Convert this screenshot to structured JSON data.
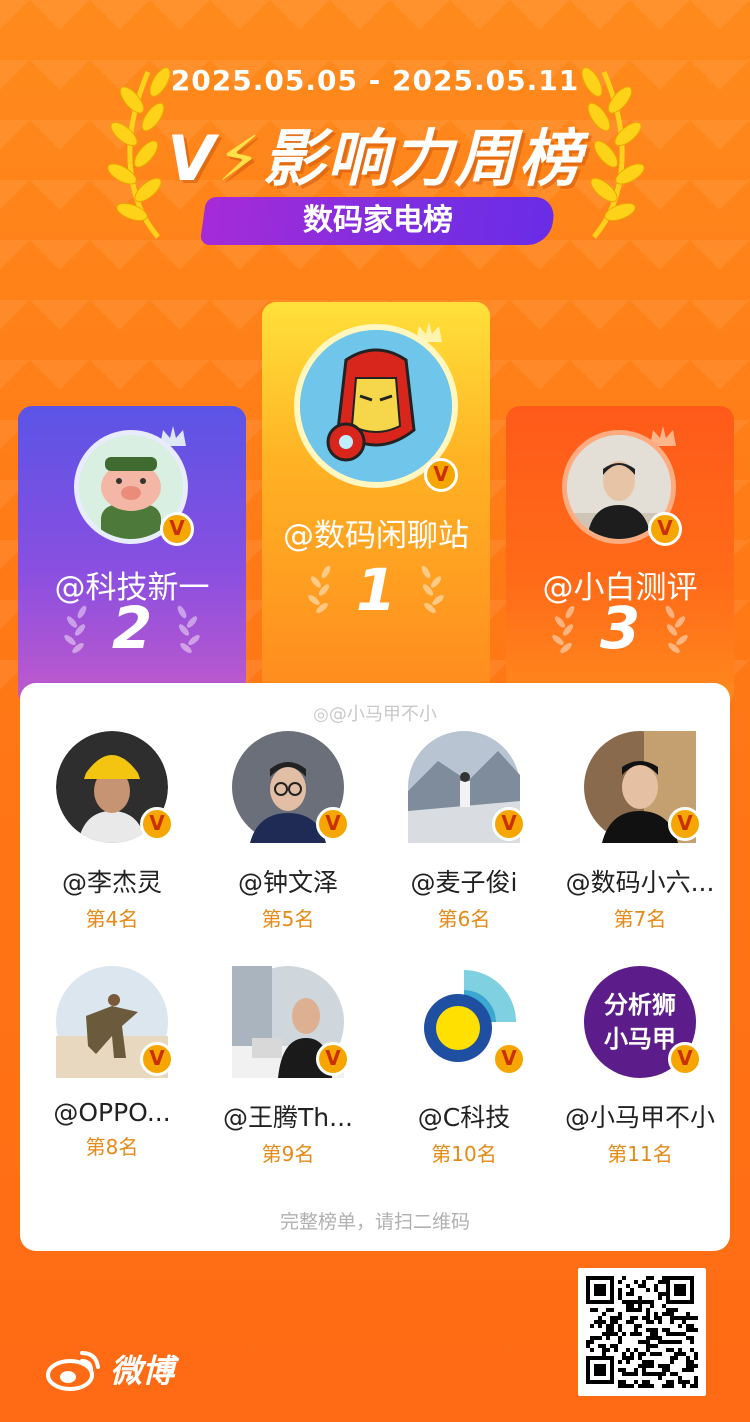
{
  "header": {
    "date_range": "2025.05.05 - 2025.05.11",
    "title_prefix": "V",
    "title_bolt": "影",
    "title_rest": "响力周榜",
    "category": "数码家电榜"
  },
  "podium": [
    {
      "rank": "1",
      "name": "@数码闲聊站",
      "avatar": "iron-man-avatar"
    },
    {
      "rank": "2",
      "name": "@科技新一",
      "avatar": "pig-soldier-avatar"
    },
    {
      "rank": "3",
      "name": "@小白测评",
      "avatar": "man-black-shirt-avatar"
    }
  ],
  "watermark": "@小马甲不小",
  "list": [
    {
      "name": "@李杰灵",
      "rank": "第4名",
      "color": "#3a3a3a"
    },
    {
      "name": "@钟文泽",
      "rank": "第5名",
      "color": "#4a4f5a"
    },
    {
      "name": "@麦子俊i",
      "rank": "第6名",
      "color": "#9aa7b8"
    },
    {
      "name": "@数码小六...",
      "rank": "第7名",
      "color": "#5a4a3a"
    },
    {
      "name": "@OPPO...",
      "rank": "第8名",
      "color": "#c9d4de"
    },
    {
      "name": "@王腾Th...",
      "rank": "第9名",
      "color": "#8b8f96"
    },
    {
      "name": "@C科技",
      "rank": "第10名",
      "color": "#1e4fa0"
    },
    {
      "name": "@小马甲不小",
      "rank": "第11名",
      "color": "#5c1d8a",
      "avatar_text_1": "分析狮",
      "avatar_text_2": "小马甲"
    }
  ],
  "footer_note": "完整榜单，请扫二维码",
  "brand": "微博",
  "verified_glyph": "V",
  "colors": {
    "accent_orange": "#ff7a16",
    "rank_text": "#e58a17",
    "badge": "#f6a600"
  }
}
